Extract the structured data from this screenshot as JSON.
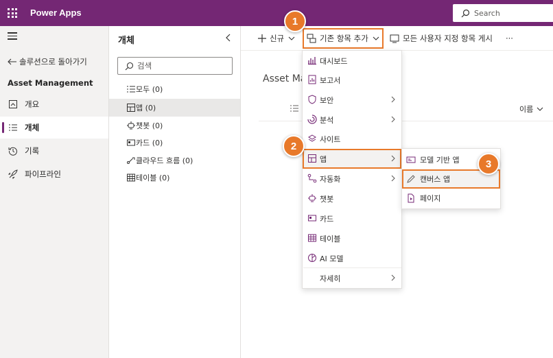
{
  "header": {
    "app_title": "Power Apps",
    "search_placeholder": "Search",
    "brand_color": "#742774"
  },
  "leftnav": {
    "back_label": "솔루션으로 돌아가기",
    "solution_name": "Asset Management",
    "items": [
      {
        "label": "개요",
        "icon": "overview-icon"
      },
      {
        "label": "개체",
        "icon": "objects-icon",
        "active": true
      },
      {
        "label": "기록",
        "icon": "history-icon"
      },
      {
        "label": "파이프라인",
        "icon": "rocket-icon"
      }
    ]
  },
  "objects_panel": {
    "title": "개체",
    "search_placeholder": "검색",
    "items": [
      {
        "label": "모두 (0)",
        "icon": "list-icon"
      },
      {
        "label": "앱 (0)",
        "icon": "app-icon",
        "selected": true
      },
      {
        "label": "챗봇 (0)",
        "icon": "chatbot-icon"
      },
      {
        "label": "카드 (0)",
        "icon": "card-icon"
      },
      {
        "label": "클라우드 흐름 (0)",
        "icon": "flow-icon"
      },
      {
        "label": "테이블 (0)",
        "icon": "table-icon"
      }
    ]
  },
  "command_bar": {
    "new_label": "신규",
    "add_existing_label": "기존 항목 추가",
    "show_all_label": "모든 사용자 지정 항목 게시",
    "more_label": "···"
  },
  "main": {
    "title": "Asset Ma",
    "sort_column": "이름"
  },
  "menu": {
    "items": [
      {
        "label": "대시보드",
        "icon": "dashboard-icon"
      },
      {
        "label": "보고서",
        "icon": "report-icon"
      },
      {
        "label": "보안",
        "icon": "shield-icon",
        "submenu": true
      },
      {
        "label": "분석",
        "icon": "analytics-icon",
        "submenu": true
      },
      {
        "label": "사이트",
        "icon": "site-icon"
      },
      {
        "label": "앱",
        "icon": "app-icon",
        "submenu": true,
        "highlighted": true
      },
      {
        "label": "자동화",
        "icon": "automation-icon",
        "submenu": true
      },
      {
        "label": "챗봇",
        "icon": "chatbot-icon"
      },
      {
        "label": "카드",
        "icon": "card-icon"
      },
      {
        "label": "테이블",
        "icon": "table-icon"
      },
      {
        "label": "AI 모델",
        "icon": "ai-model-icon"
      },
      {
        "label": "자세히",
        "icon": "",
        "submenu": true
      }
    ]
  },
  "submenu": {
    "items": [
      {
        "label": "모델 기반 앱",
        "icon": "model-app-icon"
      },
      {
        "label": "캔버스 앱",
        "icon": "pencil-icon",
        "highlighted": true
      },
      {
        "label": "페이지",
        "icon": "page-icon"
      }
    ]
  },
  "steps": [
    "1",
    "2",
    "3"
  ],
  "accent_color": "#e8792a"
}
